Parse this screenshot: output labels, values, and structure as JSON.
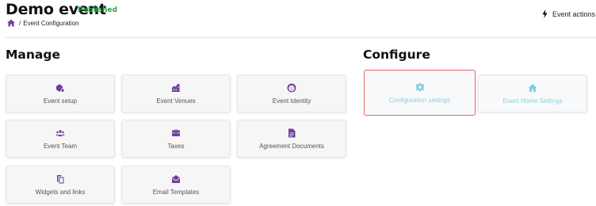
{
  "header": {
    "title": "Demo event",
    "status": "Published",
    "breadcrumb": {
      "sep": "/",
      "current": "Event Configuration"
    },
    "actions_label": "Event actions"
  },
  "manage": {
    "title": "Manage",
    "tiles": [
      {
        "label": "Event setup",
        "icon": "event-setup-icon"
      },
      {
        "label": "Event Venues",
        "icon": "venue-icon"
      },
      {
        "label": "Event Identity",
        "icon": "identity-icon"
      },
      {
        "label": "Event Team",
        "icon": "team-icon"
      },
      {
        "label": "Taxes",
        "icon": "briefcase-icon"
      },
      {
        "label": "Agreement Documents",
        "icon": "document-icon"
      },
      {
        "label": "Widgets and links",
        "icon": "copy-icon"
      },
      {
        "label": "Email Templates",
        "icon": "envelope-open-icon"
      }
    ]
  },
  "configure": {
    "title": "Configure",
    "tiles": [
      {
        "label": "Configuration settings",
        "icon": "gear-icon"
      },
      {
        "label": "Event Home Settings",
        "icon": "home-icon"
      }
    ]
  },
  "colors": {
    "accent": "#6d3f9e",
    "published": "#27a844",
    "disabled": "#8fcfe0",
    "highlight": "#e46565"
  }
}
